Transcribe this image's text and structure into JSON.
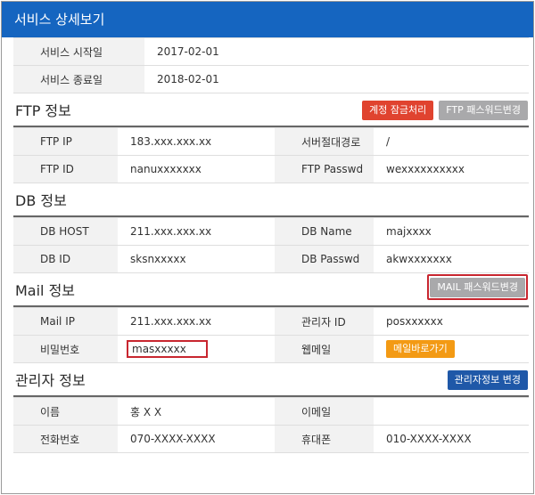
{
  "window": {
    "title": "서비스 상세보기"
  },
  "service": {
    "rows": [
      {
        "label": "서비스 시작일",
        "value": "2017-02-01"
      },
      {
        "label": "서비스 종료일",
        "value": "2018-02-01"
      }
    ]
  },
  "ftp": {
    "title": "FTP 정보",
    "lock_button": "계정 잠금처리",
    "pw_button": "FTP 패스워드변경",
    "ip_label": "FTP IP",
    "ip_value": "183.xxx.xxx.xx",
    "path_label": "서버절대경로",
    "path_value": "/",
    "id_label": "FTP ID",
    "id_value": "nanuxxxxxxx",
    "pw_label": "FTP Passwd",
    "pw_value": "wexxxxxxxxxx"
  },
  "db": {
    "title": "DB 정보",
    "host_label": "DB HOST",
    "host_value": "211.xxx.xxx.xx",
    "name_label": "DB Name",
    "name_value": "majxxxx",
    "id_label": "DB ID",
    "id_value": "sksnxxxxx",
    "pw_label": "DB Passwd",
    "pw_value": "akwxxxxxxx"
  },
  "mail": {
    "title": "Mail 정보",
    "pw_button": "MAIL 패스워드변경",
    "ip_label": "Mail IP",
    "ip_value": "211.xxx.xxx.xx",
    "admin_label": "관리자 ID",
    "admin_value": "posxxxxxx",
    "pw_label": "비밀번호",
    "pw_value": "masxxxxx",
    "webmail_label": "웹메일",
    "webmail_button": "메일바로가기"
  },
  "admin": {
    "title": "관리자 정보",
    "change_button": "관리자정보 변경",
    "name_label": "이름",
    "name_value": "홍 X X",
    "email_label": "이메일",
    "email_value": "",
    "phone_label": "전화번호",
    "phone_value": "070-XXXX-XXXX",
    "mobile_label": "휴대폰",
    "mobile_value": "010-XXXX-XXXX"
  },
  "colors": {
    "titlebar": "#1565c0",
    "red_button": "#e0432f",
    "gray_button": "#a9a9ab",
    "navy_button": "#1f58a8",
    "orange_button": "#f39a14",
    "highlight": "#c8262f"
  }
}
